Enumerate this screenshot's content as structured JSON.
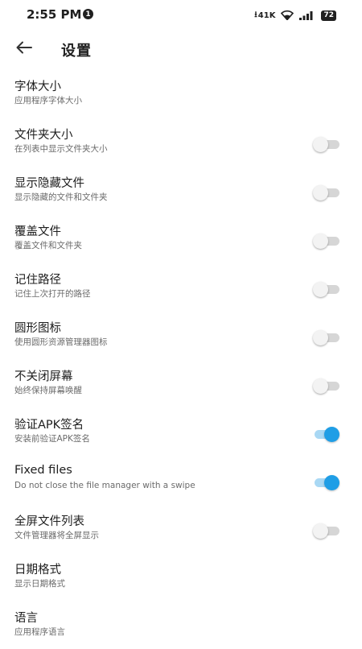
{
  "status_bar": {
    "time": "2:55 PM",
    "notification_count": "1",
    "net_speed": "41K",
    "battery": "72"
  },
  "header": {
    "title": "设置",
    "back_icon": "arrow-left-icon"
  },
  "colors": {
    "switch_on": "#1f9ee6",
    "switch_off": "#f3f3f3"
  },
  "settings": [
    {
      "title": "字体大小",
      "subtitle": "应用程序字体大小"
    },
    {
      "title": "文件夹大小",
      "subtitle": "在列表中显示文件夹大小",
      "switch": false
    },
    {
      "title": "显示隐藏文件",
      "subtitle": "显示隐藏的文件和文件夹",
      "switch": false
    },
    {
      "title": "覆盖文件",
      "subtitle": "覆盖文件和文件夹",
      "switch": false
    },
    {
      "title": "记住路径",
      "subtitle": "记住上次打开的路径",
      "switch": false
    },
    {
      "title": "圆形图标",
      "subtitle": "使用圆形资源管理器图标",
      "switch": false
    },
    {
      "title": "不关闭屏幕",
      "subtitle": "始终保持屏幕唤醒",
      "switch": false
    },
    {
      "title": "验证APK签名",
      "subtitle": "安装前验证APK签名",
      "switch": true
    },
    {
      "title": "Fixed files",
      "subtitle": "Do not close the file manager with a swipe",
      "switch": true
    },
    {
      "title": "全屏文件列表",
      "subtitle": "文件管理器将全屏显示",
      "switch": false
    },
    {
      "title": "日期格式",
      "subtitle": "显示日期格式"
    },
    {
      "title": "语言",
      "subtitle": "应用程序语言"
    }
  ]
}
